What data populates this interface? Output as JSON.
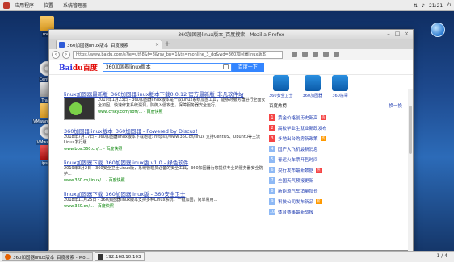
{
  "top_panel": {
    "menu": [
      "应用程序",
      "位置",
      "系统管理器"
    ],
    "clock": "21:21",
    "right_icons": [
      "network-icon",
      "volume-icon",
      "power-icon"
    ]
  },
  "desktop": {
    "icons": [
      {
        "label": "root",
        "kind": "folder"
      },
      {
        "label": "CentOS",
        "kind": "disc"
      },
      {
        "label": "Trash",
        "kind": "trash"
      },
      {
        "label": "VMware Tools",
        "kind": "folder"
      },
      {
        "label": "VMware...",
        "kind": "disc"
      },
      {
        "label": "ipsec",
        "kind": "red"
      }
    ]
  },
  "browser": {
    "window_title": "360加固器linux版本_百度搜索 - Mozilla Firefox",
    "tab_title": "360加固器linux版本_百度搜索",
    "new_tab": "+",
    "url": "https://www.baidu.com/s?ie=utf-8&f=8&rsv_bp=1&tn=monline_3_dg&wd=360加固器linux版本",
    "search_query": "360加固器linux版本",
    "search_button": "百度一下",
    "logo_text": "Bai",
    "logo_red": "du百度"
  },
  "results": [
    {
      "title": "linux加固器最新版_360加固器linux版本下载0.0.12 官方最新版_非凡软件站",
      "desc": "2019年1月23日 - 360加固器linux版本是一款Linux系统加固工具，能够对服务器进行全面安全加固，快速修复系统漏洞，防御入侵攻击，保障服务器安全运行。",
      "url": "www.crsky.com/soft/...  - 百度快照",
      "has_thumb": true
    },
    {
      "title": "360加固器linux版本_360加固器 - Powered by Discuz!",
      "desc": "2018年7月17日 - 360加固器linux版本下载地址: https://www.360.cn/linux 支持CentOS、Ubuntu等主流Linux发行版...",
      "url": "www.bbs.360.cn/... - 百度快照",
      "has_thumb": false
    },
    {
      "title": "linux加固器下载_360加固器linux版 v1.0 - 绿色软件",
      "desc": "2019年3月2日 - 360安全卫士Linux版，系统管理员必备的安全工具，360加固器为您提供专业的服务器安全防护...",
      "url": "www.360.cn/linux/... - 百度快照",
      "has_thumb": false
    },
    {
      "title": "linux加固器下载_360加固器linux版 - 360安全卫士",
      "desc": "2018年11月25日 - 360加固器linux版本支持多种Linux系统，一键加固，简单易用...",
      "url": "www.360.cn/... - 百度快照",
      "has_thumb": false
    }
  ],
  "right_column": {
    "apps": [
      {
        "label": "360安全卫士"
      },
      {
        "label": "360加固器"
      },
      {
        "label": "360杀毒"
      }
    ],
    "hot_title": "百度热榜",
    "hot_more": "换一换",
    "hot_items": [
      {
        "num": "1",
        "text": "黄金价格创历史新高",
        "tag": "热"
      },
      {
        "num": "2",
        "text": "高校毕业生就业新政发布",
        "tag": ""
      },
      {
        "num": "3",
        "text": "多地出台购房新政策",
        "tag": "新"
      },
      {
        "num": "4",
        "text": "国产大飞机最新消息",
        "tag": ""
      },
      {
        "num": "5",
        "text": "春运火车票开售时间",
        "tag": ""
      },
      {
        "num": "6",
        "text": "央行发布最新数据",
        "tag": "热"
      },
      {
        "num": "7",
        "text": "全国天气预报更新",
        "tag": ""
      },
      {
        "num": "8",
        "text": "新能源汽车销量增长",
        "tag": ""
      },
      {
        "num": "9",
        "text": "科技公司发布新品",
        "tag": "新"
      },
      {
        "num": "10",
        "text": "体育赛事最新战报",
        "tag": ""
      }
    ]
  },
  "taskbar": {
    "firefox_task": "360加固器linux版本_百度搜索 - Mo...",
    "terminal_task": "192.168.10.103",
    "pager": "1 / 4"
  }
}
